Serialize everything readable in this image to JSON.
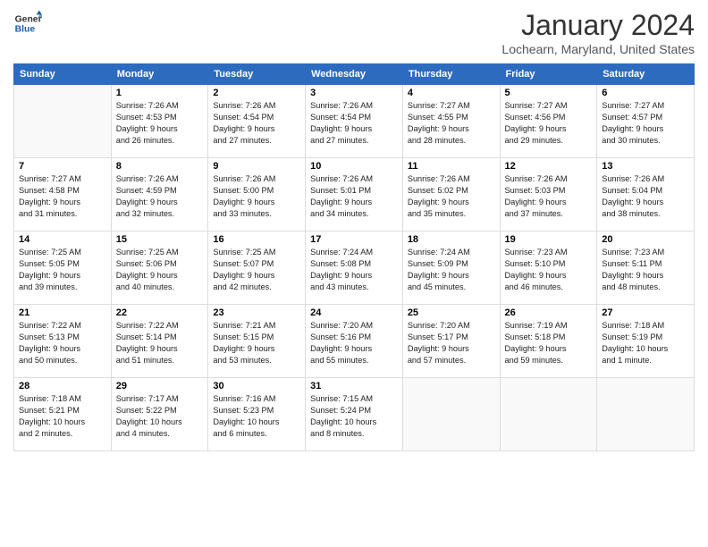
{
  "header": {
    "logo": {
      "line1": "General",
      "line2": "Blue"
    },
    "title": "January 2024",
    "location": "Lochearn, Maryland, United States"
  },
  "weekdays": [
    "Sunday",
    "Monday",
    "Tuesday",
    "Wednesday",
    "Thursday",
    "Friday",
    "Saturday"
  ],
  "weeks": [
    [
      {
        "day": "",
        "info": ""
      },
      {
        "day": "1",
        "info": "Sunrise: 7:26 AM\nSunset: 4:53 PM\nDaylight: 9 hours\nand 26 minutes."
      },
      {
        "day": "2",
        "info": "Sunrise: 7:26 AM\nSunset: 4:54 PM\nDaylight: 9 hours\nand 27 minutes."
      },
      {
        "day": "3",
        "info": "Sunrise: 7:26 AM\nSunset: 4:54 PM\nDaylight: 9 hours\nand 27 minutes."
      },
      {
        "day": "4",
        "info": "Sunrise: 7:27 AM\nSunset: 4:55 PM\nDaylight: 9 hours\nand 28 minutes."
      },
      {
        "day": "5",
        "info": "Sunrise: 7:27 AM\nSunset: 4:56 PM\nDaylight: 9 hours\nand 29 minutes."
      },
      {
        "day": "6",
        "info": "Sunrise: 7:27 AM\nSunset: 4:57 PM\nDaylight: 9 hours\nand 30 minutes."
      }
    ],
    [
      {
        "day": "7",
        "info": "Sunrise: 7:27 AM\nSunset: 4:58 PM\nDaylight: 9 hours\nand 31 minutes."
      },
      {
        "day": "8",
        "info": "Sunrise: 7:26 AM\nSunset: 4:59 PM\nDaylight: 9 hours\nand 32 minutes."
      },
      {
        "day": "9",
        "info": "Sunrise: 7:26 AM\nSunset: 5:00 PM\nDaylight: 9 hours\nand 33 minutes."
      },
      {
        "day": "10",
        "info": "Sunrise: 7:26 AM\nSunset: 5:01 PM\nDaylight: 9 hours\nand 34 minutes."
      },
      {
        "day": "11",
        "info": "Sunrise: 7:26 AM\nSunset: 5:02 PM\nDaylight: 9 hours\nand 35 minutes."
      },
      {
        "day": "12",
        "info": "Sunrise: 7:26 AM\nSunset: 5:03 PM\nDaylight: 9 hours\nand 37 minutes."
      },
      {
        "day": "13",
        "info": "Sunrise: 7:26 AM\nSunset: 5:04 PM\nDaylight: 9 hours\nand 38 minutes."
      }
    ],
    [
      {
        "day": "14",
        "info": "Sunrise: 7:25 AM\nSunset: 5:05 PM\nDaylight: 9 hours\nand 39 minutes."
      },
      {
        "day": "15",
        "info": "Sunrise: 7:25 AM\nSunset: 5:06 PM\nDaylight: 9 hours\nand 40 minutes."
      },
      {
        "day": "16",
        "info": "Sunrise: 7:25 AM\nSunset: 5:07 PM\nDaylight: 9 hours\nand 42 minutes."
      },
      {
        "day": "17",
        "info": "Sunrise: 7:24 AM\nSunset: 5:08 PM\nDaylight: 9 hours\nand 43 minutes."
      },
      {
        "day": "18",
        "info": "Sunrise: 7:24 AM\nSunset: 5:09 PM\nDaylight: 9 hours\nand 45 minutes."
      },
      {
        "day": "19",
        "info": "Sunrise: 7:23 AM\nSunset: 5:10 PM\nDaylight: 9 hours\nand 46 minutes."
      },
      {
        "day": "20",
        "info": "Sunrise: 7:23 AM\nSunset: 5:11 PM\nDaylight: 9 hours\nand 48 minutes."
      }
    ],
    [
      {
        "day": "21",
        "info": "Sunrise: 7:22 AM\nSunset: 5:13 PM\nDaylight: 9 hours\nand 50 minutes."
      },
      {
        "day": "22",
        "info": "Sunrise: 7:22 AM\nSunset: 5:14 PM\nDaylight: 9 hours\nand 51 minutes."
      },
      {
        "day": "23",
        "info": "Sunrise: 7:21 AM\nSunset: 5:15 PM\nDaylight: 9 hours\nand 53 minutes."
      },
      {
        "day": "24",
        "info": "Sunrise: 7:20 AM\nSunset: 5:16 PM\nDaylight: 9 hours\nand 55 minutes."
      },
      {
        "day": "25",
        "info": "Sunrise: 7:20 AM\nSunset: 5:17 PM\nDaylight: 9 hours\nand 57 minutes."
      },
      {
        "day": "26",
        "info": "Sunrise: 7:19 AM\nSunset: 5:18 PM\nDaylight: 9 hours\nand 59 minutes."
      },
      {
        "day": "27",
        "info": "Sunrise: 7:18 AM\nSunset: 5:19 PM\nDaylight: 10 hours\nand 1 minute."
      }
    ],
    [
      {
        "day": "28",
        "info": "Sunrise: 7:18 AM\nSunset: 5:21 PM\nDaylight: 10 hours\nand 2 minutes."
      },
      {
        "day": "29",
        "info": "Sunrise: 7:17 AM\nSunset: 5:22 PM\nDaylight: 10 hours\nand 4 minutes."
      },
      {
        "day": "30",
        "info": "Sunrise: 7:16 AM\nSunset: 5:23 PM\nDaylight: 10 hours\nand 6 minutes."
      },
      {
        "day": "31",
        "info": "Sunrise: 7:15 AM\nSunset: 5:24 PM\nDaylight: 10 hours\nand 8 minutes."
      },
      {
        "day": "",
        "info": ""
      },
      {
        "day": "",
        "info": ""
      },
      {
        "day": "",
        "info": ""
      }
    ]
  ]
}
